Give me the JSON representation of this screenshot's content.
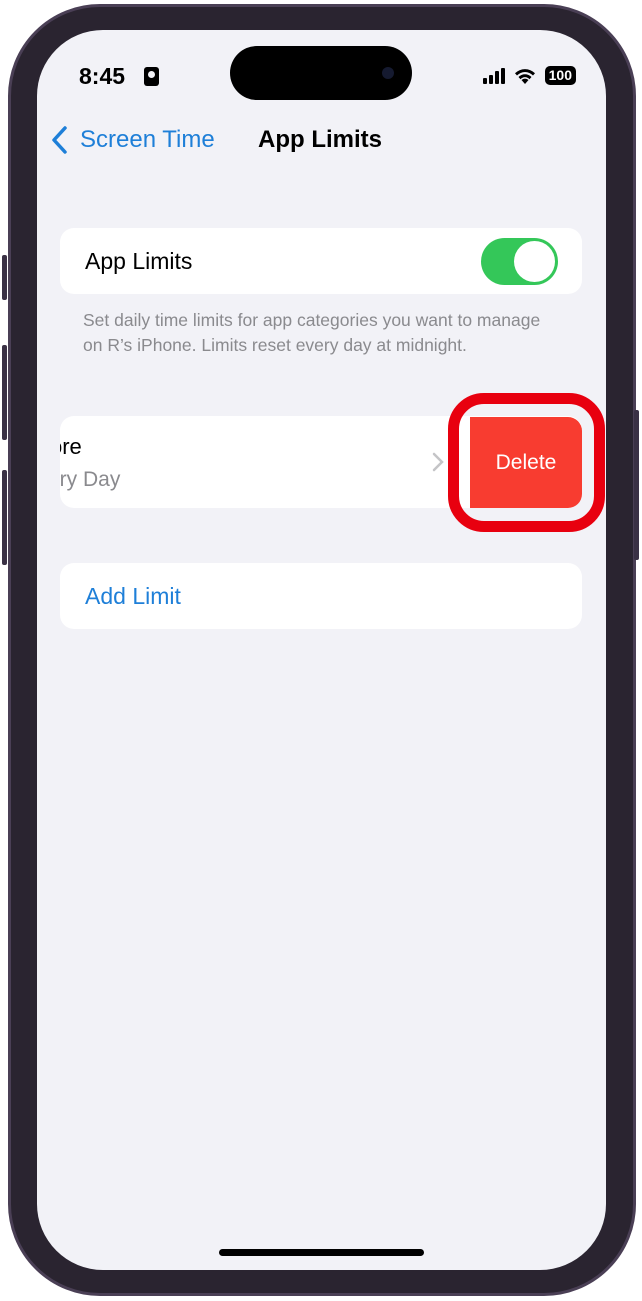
{
  "status_bar": {
    "time": "8:45",
    "battery": "100",
    "icons": [
      "contact-card-icon",
      "signal-icon",
      "wifi-icon",
      "battery-icon"
    ]
  },
  "nav": {
    "back_label": "Screen Time",
    "title": "App Limits"
  },
  "app_limits_toggle": {
    "label": "App Limits",
    "on": true
  },
  "footer": "Set daily time limits for app categories you want to manage on R’s iPhone. Limits reset every day at midnight.",
  "limit_row": {
    "title": "ore",
    "subtitle": "ery Day",
    "delete_label": "Delete"
  },
  "add_limit": "Add Limit",
  "colors": {
    "accent": "#1e7fd8",
    "toggle_on": "#34c759",
    "delete": "#f83c30",
    "highlight": "#e8000f"
  }
}
